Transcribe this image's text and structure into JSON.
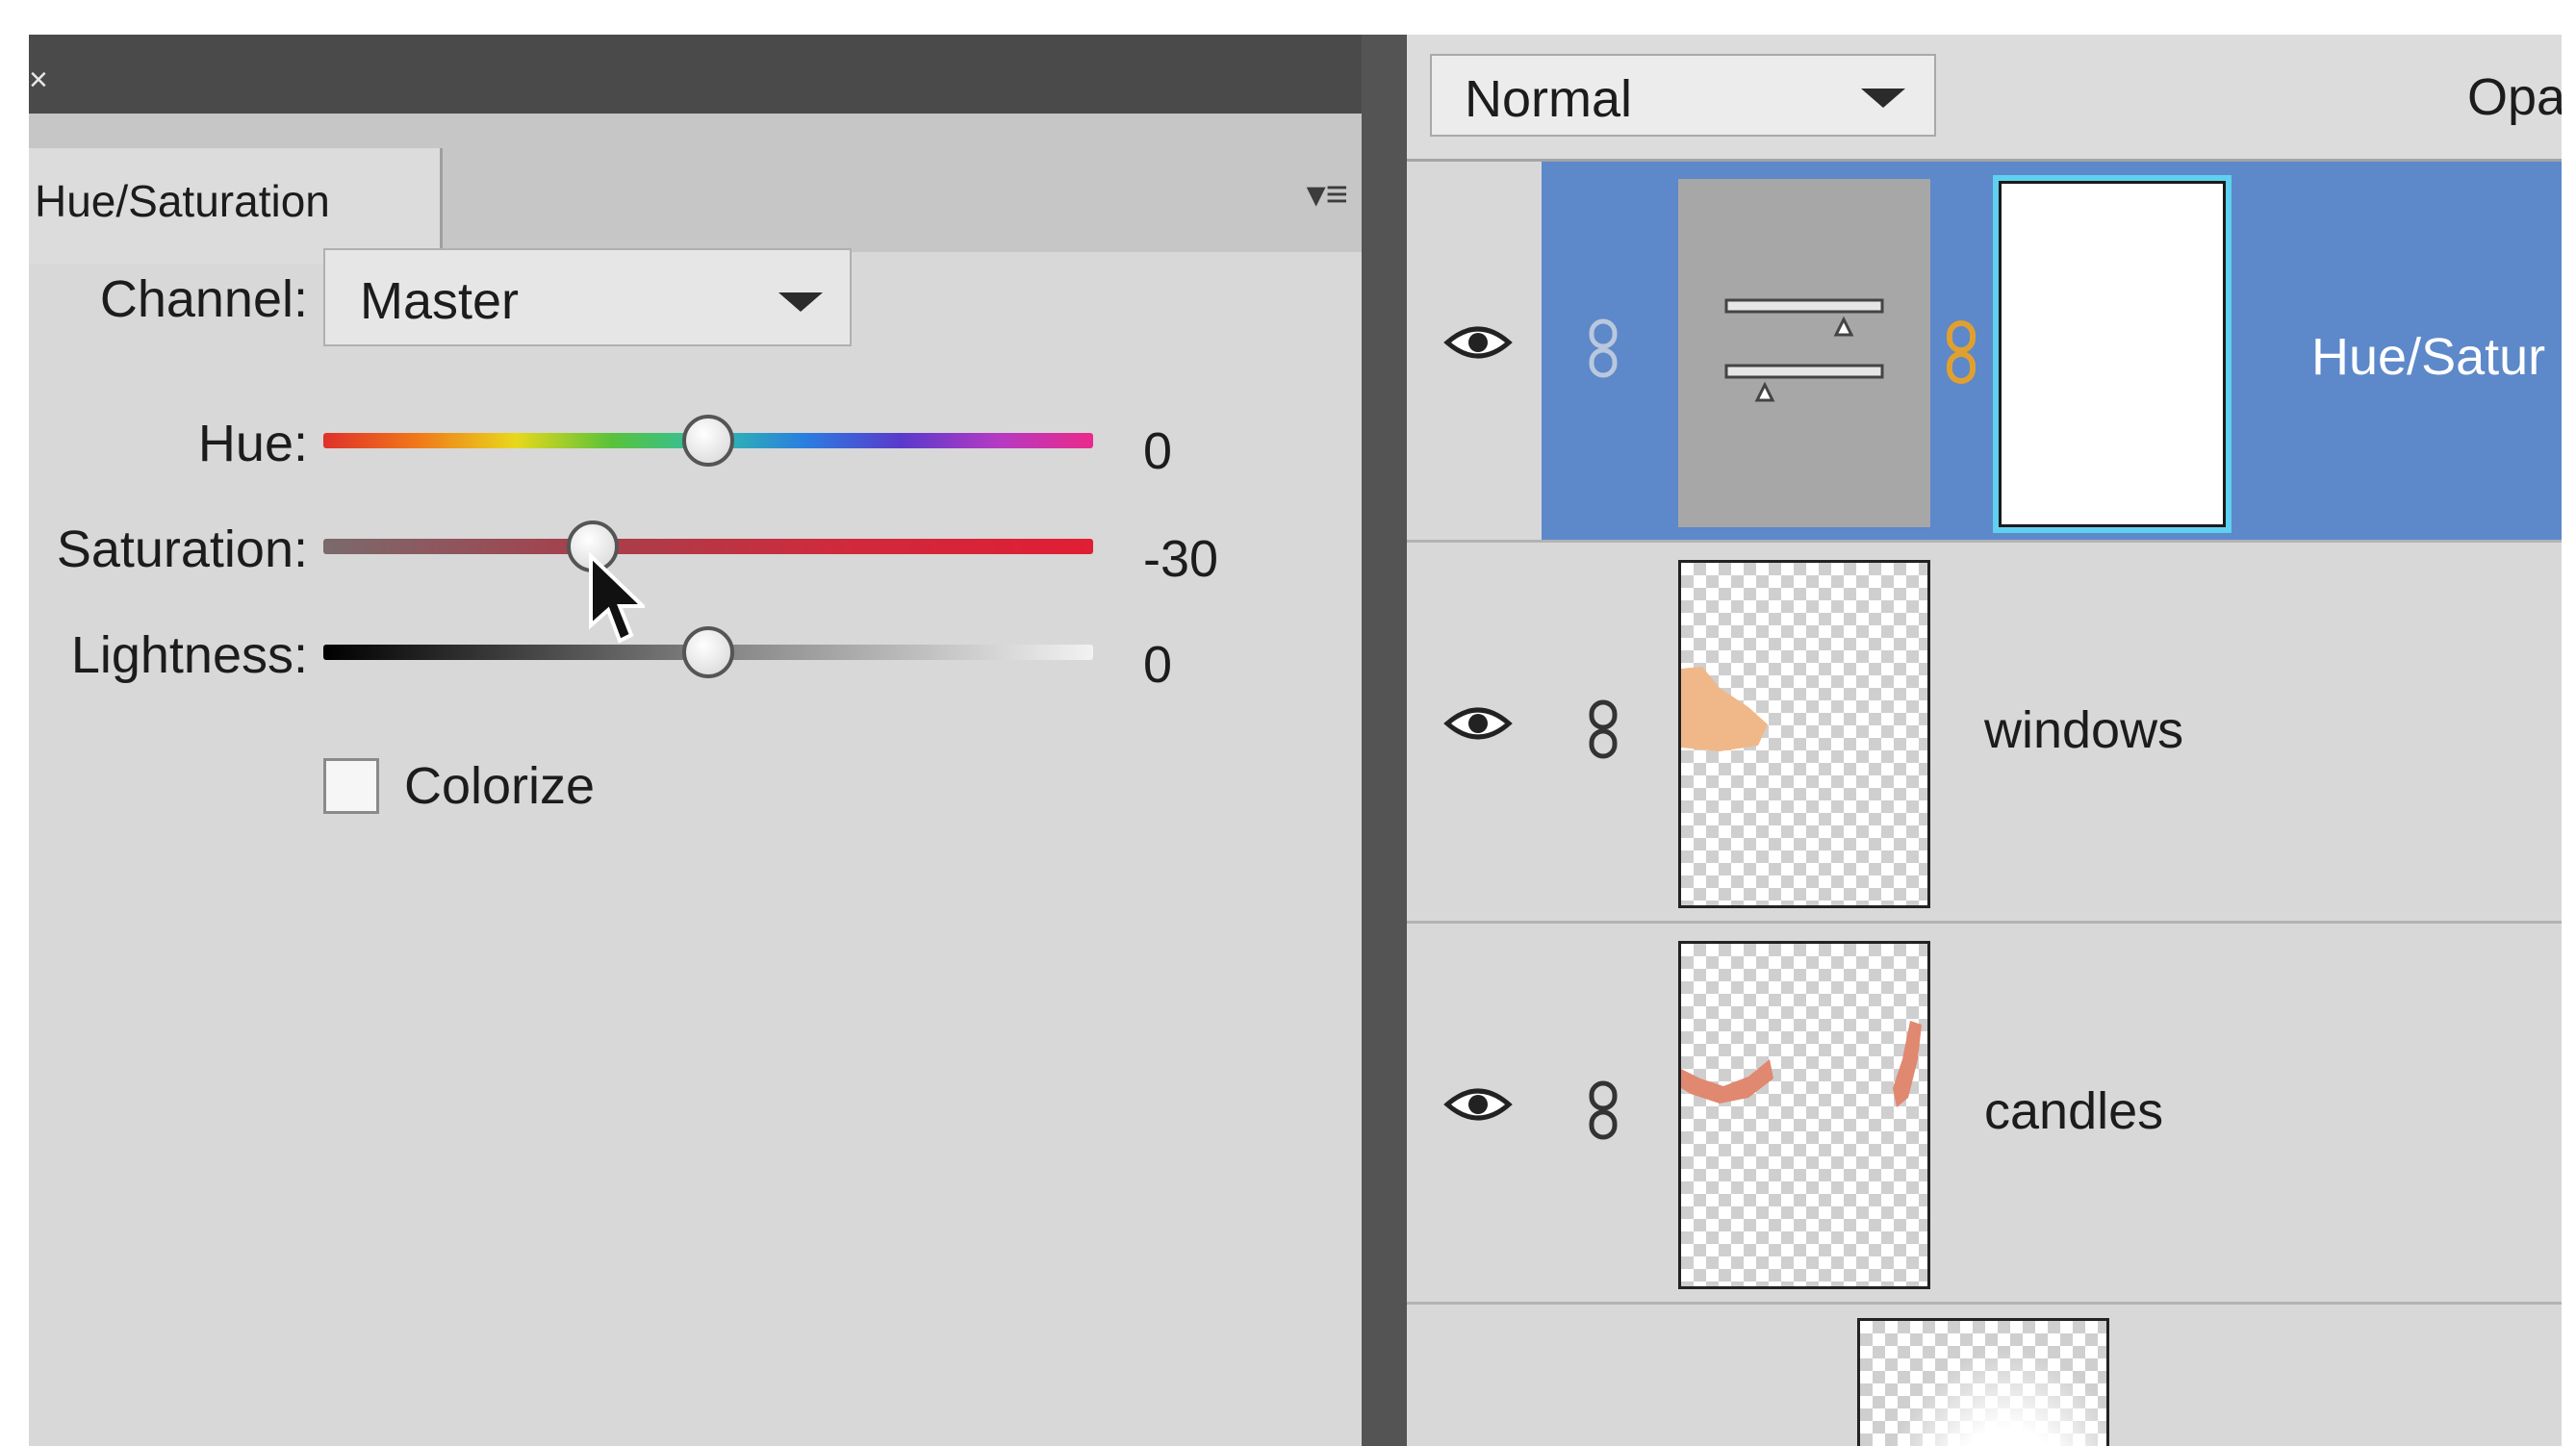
{
  "properties_panel": {
    "tab_label": "Hue/Saturation",
    "close_glyph": "×",
    "menu_icon": "panel-menu-icon",
    "channel": {
      "label": "Channel:",
      "value": "Master"
    },
    "sliders": [
      {
        "label": "Hue:",
        "value": "0",
        "position_fraction": 0.5
      },
      {
        "label": "Saturation:",
        "value": "-30",
        "position_fraction": 0.35
      },
      {
        "label": "Lightness:",
        "value": "0",
        "position_fraction": 0.5
      }
    ],
    "colorize": {
      "label": "Colorize",
      "checked": false
    }
  },
  "layers_panel": {
    "blend_mode": "Normal",
    "opacity_label": "Opa",
    "layers": [
      {
        "name": "Hue/Satur",
        "type": "adjustment",
        "selected": true,
        "visible": true
      },
      {
        "name": "windows",
        "type": "pixel",
        "selected": false,
        "visible": true
      },
      {
        "name": "candles",
        "type": "pixel",
        "selected": false,
        "visible": true
      },
      {
        "name": "",
        "type": "pixel",
        "selected": false,
        "visible": true
      }
    ]
  },
  "colors": {
    "selection": "#5d88c9",
    "mask_highlight": "#5fd0f0",
    "panel_bg": "#d8d8d8",
    "divider": "#545454"
  }
}
